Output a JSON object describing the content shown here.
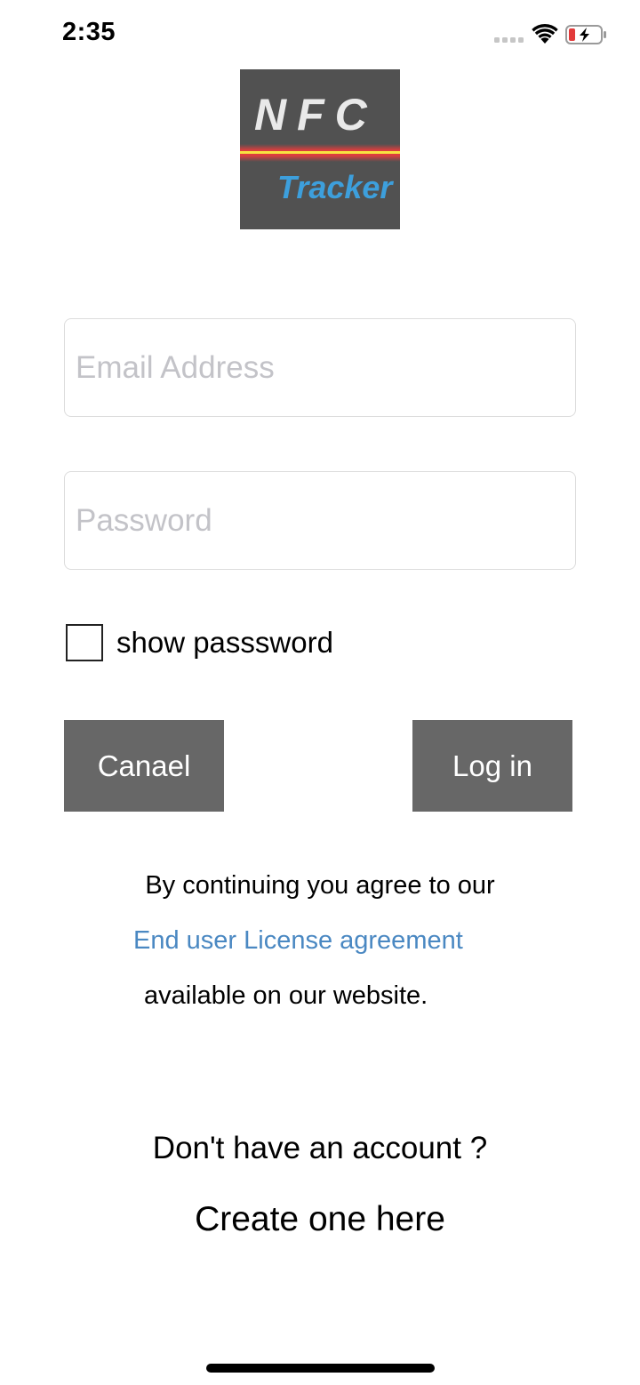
{
  "status_bar": {
    "time": "2:35"
  },
  "logo": {
    "top_text": "NFC",
    "bottom_text": "Tracker",
    "background_color": "#515151",
    "tracker_color": "#3d9fdc"
  },
  "form": {
    "email_placeholder": "Email Address",
    "email_value": "",
    "password_placeholder": "Password",
    "password_value": "",
    "show_password_label": "show passsword",
    "show_password_checked": false
  },
  "buttons": {
    "cancel_label": "Canael",
    "login_label": "Log in",
    "button_color": "#676767"
  },
  "agreement": {
    "line1": "By continuing you agree to our",
    "link_text": "End user License agreement",
    "line3": "available on our website.",
    "link_color": "#4a88c2"
  },
  "account": {
    "prompt": "Don't have an account ?",
    "create_link": "Create one here"
  },
  "icons": {
    "signal": "cellular-signal-icon",
    "wifi": "wifi-icon",
    "battery": "battery-charging-icon"
  }
}
